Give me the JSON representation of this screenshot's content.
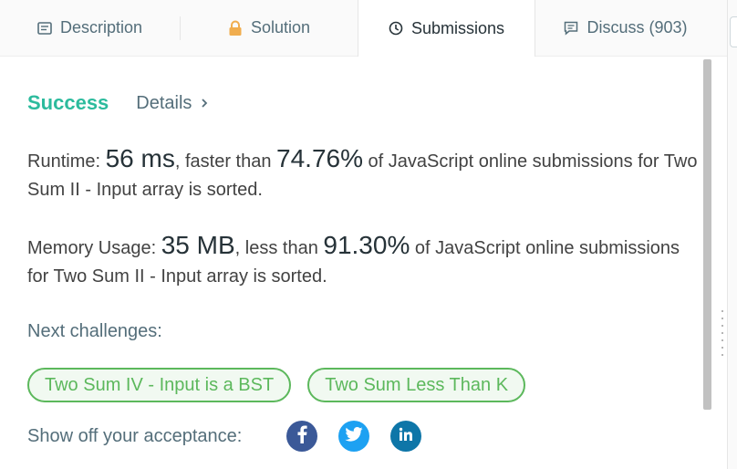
{
  "tabs": [
    {
      "label": "Description",
      "icon": "description-icon"
    },
    {
      "label": "Solution",
      "icon": "lock-icon"
    },
    {
      "label": "Submissions",
      "icon": "clock-icon",
      "active": true
    },
    {
      "label": "Discuss (903)",
      "icon": "comment-icon"
    }
  ],
  "status": {
    "result": "Success",
    "details_label": "Details",
    "result_color": "#2cbb9d"
  },
  "runtime": {
    "label": "Runtime: ",
    "value": "56 ms",
    "comparison": ", faster than ",
    "percent": "74.76%",
    "suffix": " of JavaScript online submissions for Two Sum II - Input array is sorted."
  },
  "memory": {
    "label": "Memory Usage: ",
    "value": "35 MB",
    "comparison": ", less than ",
    "percent": "91.30%",
    "suffix": " of JavaScript online submissions for Two Sum II - Input array is sorted."
  },
  "next_challenges": {
    "label": "Next challenges:",
    "items": [
      "Two Sum IV - Input is a BST",
      "Two Sum Less Than K"
    ],
    "chip_color": "#5cb85c"
  },
  "share": {
    "label": "Show off your acceptance:",
    "networks": [
      {
        "name": "facebook",
        "color": "#3b5998",
        "icon": "facebook-icon"
      },
      {
        "name": "twitter",
        "color": "#1da1f2",
        "icon": "twitter-icon"
      },
      {
        "name": "linkedin",
        "color": "#0e76a8",
        "icon": "linkedin-icon"
      }
    ]
  }
}
